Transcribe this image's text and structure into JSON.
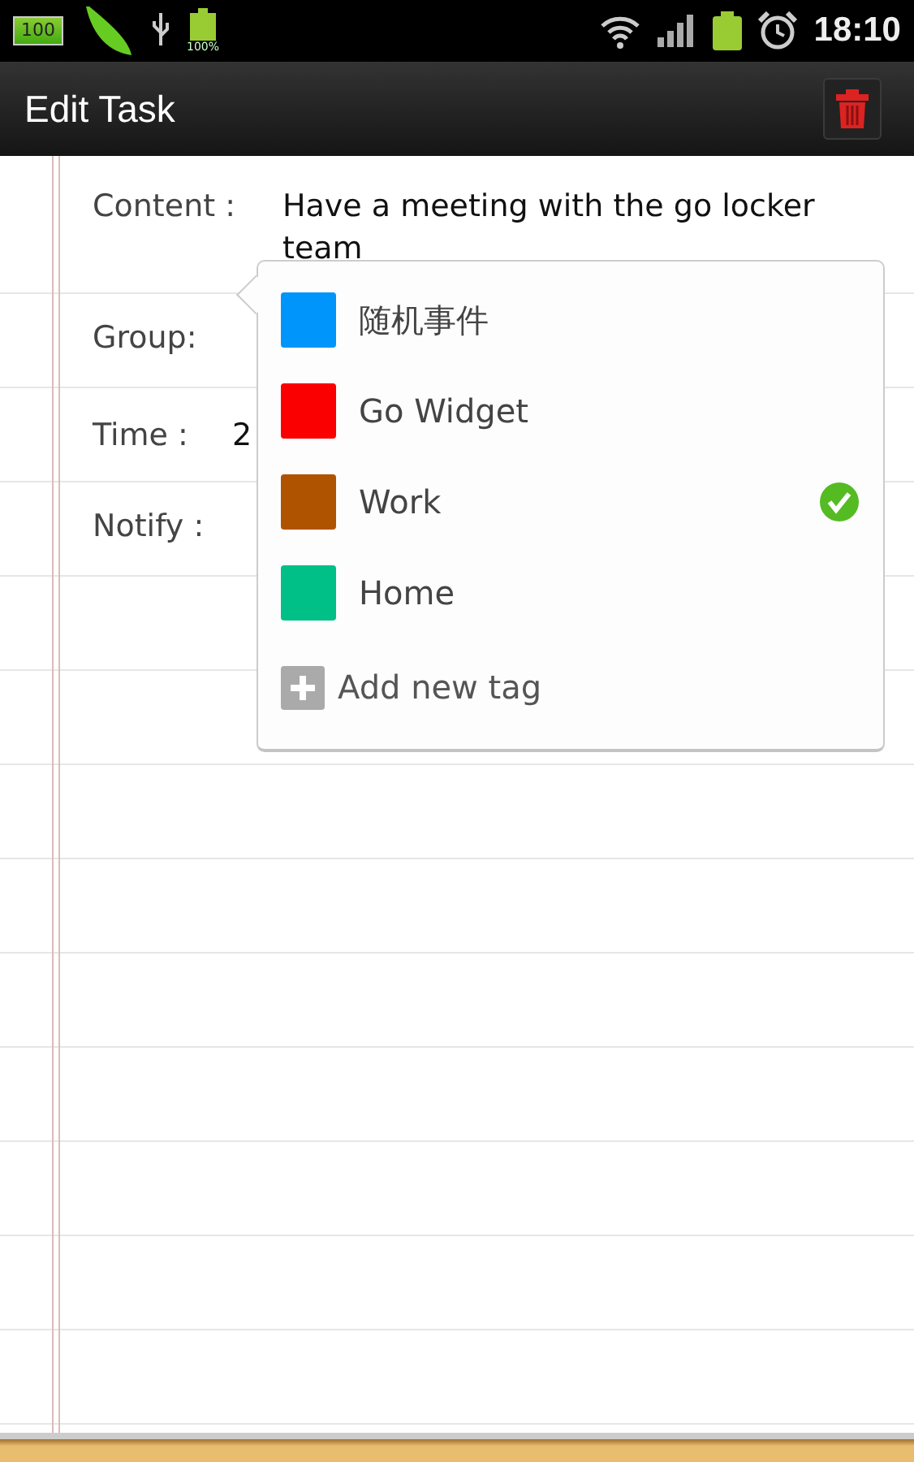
{
  "status_bar": {
    "battery_badge": "100",
    "battery_percent": "100%",
    "time": "18:10"
  },
  "title_bar": {
    "title": "Edit Task"
  },
  "form": [
    {
      "kind": "text",
      "label": "Content :",
      "value": "Have a meeting with the go locker team"
    },
    {
      "kind": "group",
      "label": "Group:"
    },
    {
      "kind": "text",
      "label": "Time :",
      "value": "2"
    },
    {
      "kind": "text",
      "label": "Notify :"
    }
  ],
  "tag_popup": {
    "tags": [
      {
        "name": "随机事件",
        "color": "#0095fa",
        "selected": false
      },
      {
        "name": "Go Widget",
        "color": "#fa0000",
        "selected": false
      },
      {
        "name": "Work",
        "color": "#b05300",
        "selected": true
      },
      {
        "name": "Home",
        "color": "#00c088",
        "selected": false
      }
    ],
    "add_label": "Add new tag"
  }
}
